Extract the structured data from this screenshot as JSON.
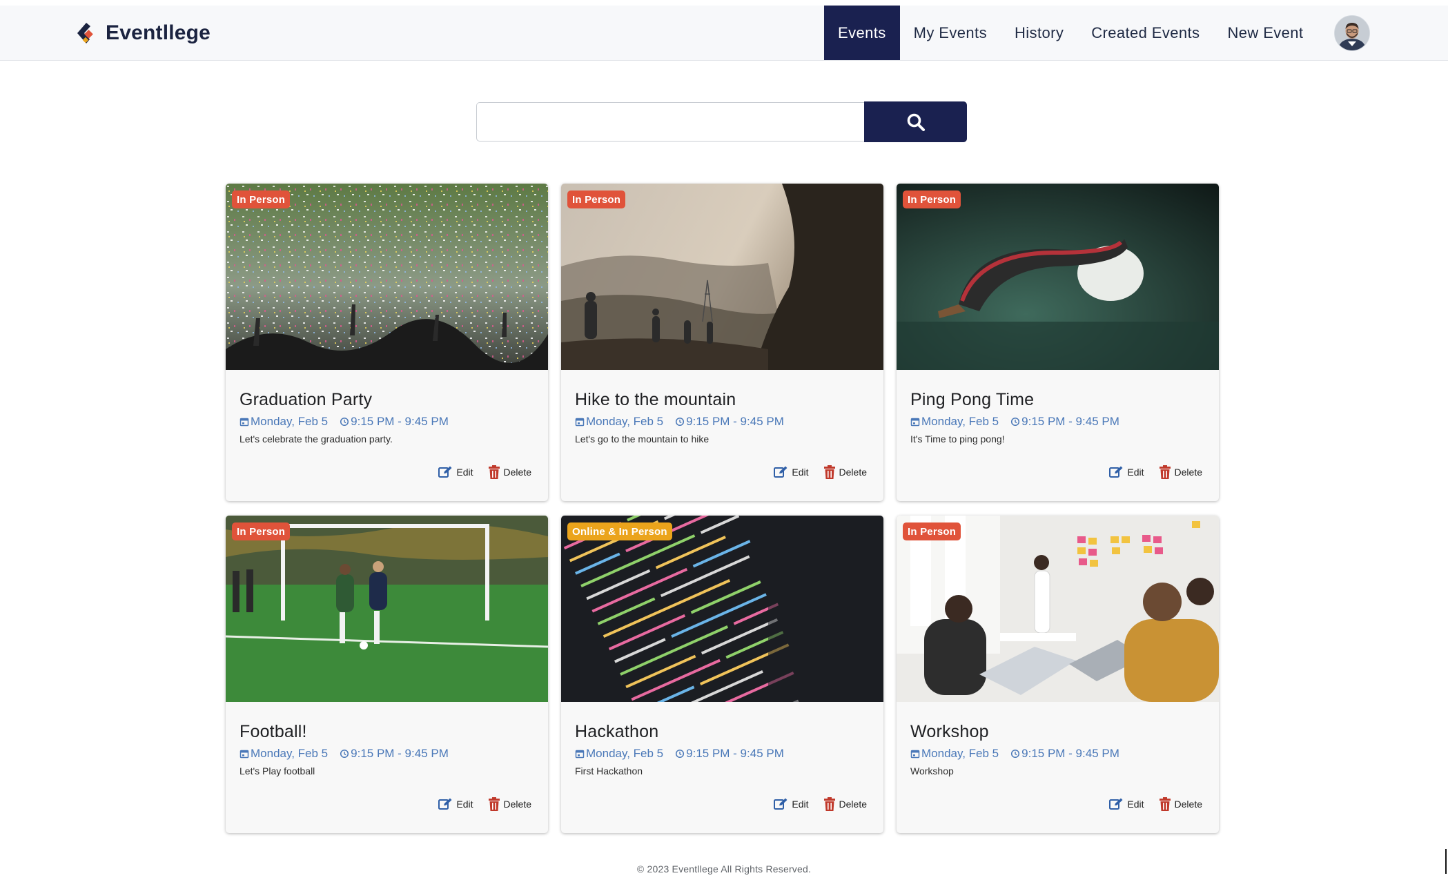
{
  "app": {
    "name": "Eventllege"
  },
  "nav": {
    "items": [
      "Events",
      "My Events",
      "History",
      "Created Events",
      "New Event"
    ],
    "active": "Events"
  },
  "search": {
    "value": "",
    "placeholder": ""
  },
  "colors": {
    "primary": "#1a2150",
    "in_person": "#e0533a",
    "online": "#eba41c",
    "meta": "#4a78b8",
    "delete": "#c0392b"
  },
  "cards": [
    {
      "badge": "In Person",
      "title": "Graduation Party",
      "date": "Monday, Feb 5",
      "time": "9:15 PM - 9:45 PM",
      "description": "Let's celebrate the graduation party.",
      "image": "confetti-crowd"
    },
    {
      "badge": "In Person",
      "title": "Hike to the mountain",
      "date": "Monday, Feb 5",
      "time": "9:15 PM - 9:45 PM",
      "description": "Let's go to the mountain to hike",
      "image": "hikers-sunset"
    },
    {
      "badge": "In Person",
      "title": "Ping Pong Time",
      "date": "Monday, Feb 5",
      "time": "9:15 PM - 9:45 PM",
      "description": "It's Time to ping pong!",
      "image": "ping-pong-paddle"
    },
    {
      "badge": "In Person",
      "title": "Football!",
      "date": "Monday, Feb 5",
      "time": "9:15 PM - 9:45 PM",
      "description": "Let's Play football",
      "image": "soccer-field"
    },
    {
      "badge": "Online & In Person",
      "title": "Hackathon",
      "date": "Monday, Feb 5",
      "time": "9:15 PM - 9:45 PM",
      "description": "First Hackathon",
      "image": "code-screen"
    },
    {
      "badge": "In Person",
      "title": "Workshop",
      "date": "Monday, Feb 5",
      "time": "9:15 PM - 9:45 PM",
      "description": "Workshop",
      "image": "meeting-room"
    }
  ],
  "actions": {
    "edit": "Edit",
    "delete": "Delete"
  },
  "footer": {
    "text": "© 2023 Eventllege All Rights Reserved."
  }
}
